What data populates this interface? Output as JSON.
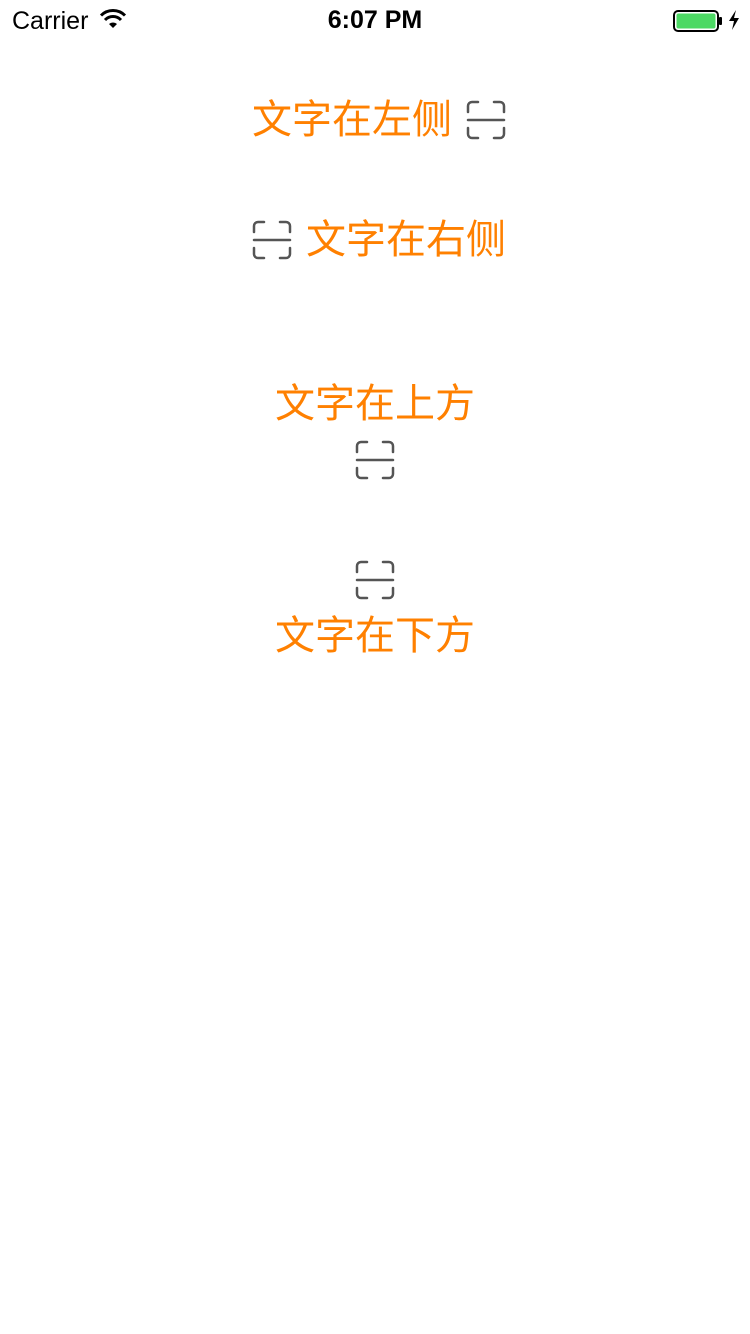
{
  "status_bar": {
    "carrier": "Carrier",
    "time": "6:07 PM",
    "battery_level": 1.0,
    "battery_color": "#4cd964",
    "charging": true
  },
  "accent_color": "#ff8000",
  "icon_color": "#555555",
  "buttons": [
    {
      "label": "文字在左侧",
      "icon": "scan-icon",
      "text_position": "left"
    },
    {
      "label": "文字在右侧",
      "icon": "scan-icon",
      "text_position": "right"
    },
    {
      "label": "文字在上方",
      "icon": "scan-icon",
      "text_position": "top"
    },
    {
      "label": "文字在下方",
      "icon": "scan-icon",
      "text_position": "bottom"
    }
  ]
}
